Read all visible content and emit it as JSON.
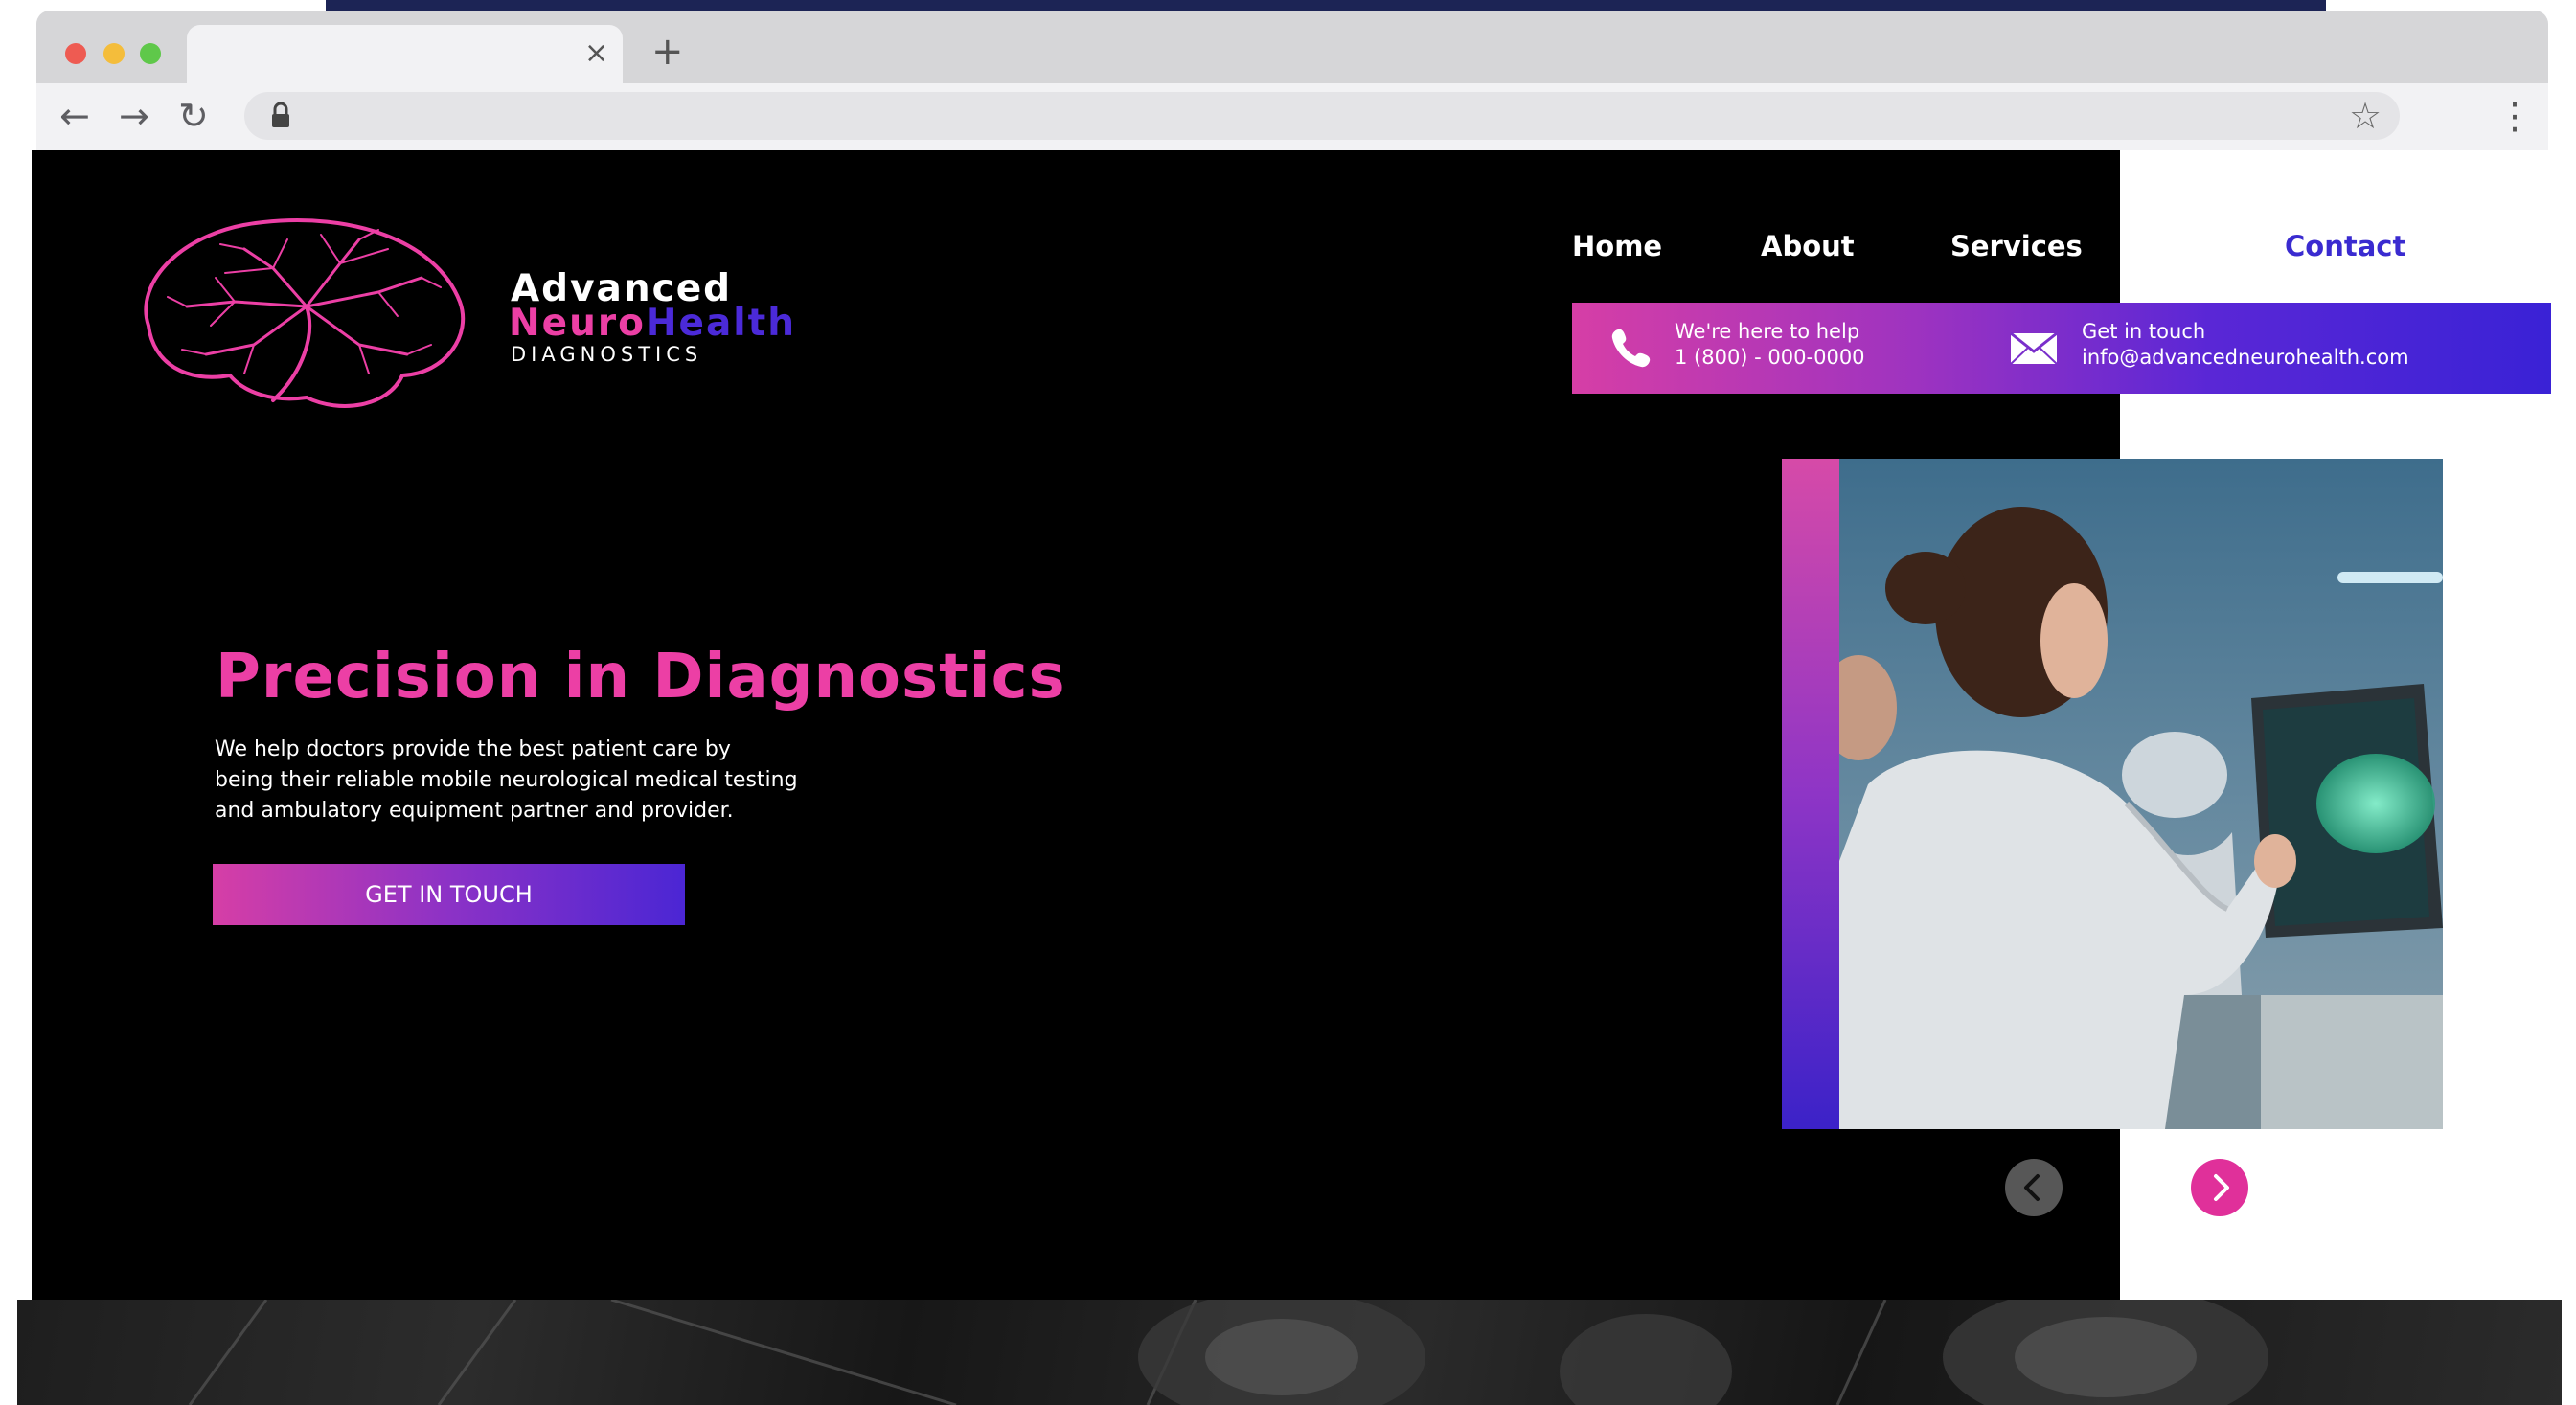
{
  "browser": {
    "tab_close_glyph": "×",
    "new_tab_glyph": "+",
    "back_glyph": "←",
    "forward_glyph": "→",
    "reload_glyph": "↻",
    "bookmark_glyph": "☆",
    "menu_glyph": "⋮",
    "icons": [
      "back-icon",
      "forward-icon",
      "reload-icon",
      "lock-icon",
      "star-icon",
      "kebab-menu-icon"
    ]
  },
  "logo": {
    "line1": "Advanced",
    "line2_part1": "Neuro",
    "line2_part2": "Health",
    "line3": "DIAGNOSTICS",
    "colors": {
      "neuro": "#ec3fa5",
      "health": "#4b2ad8",
      "brain": "#ec3fa5"
    }
  },
  "nav": {
    "items": [
      {
        "label": "Home"
      },
      {
        "label": "About"
      },
      {
        "label": "Services"
      },
      {
        "label": "Contact"
      }
    ],
    "active": "Contact",
    "active_color": "#3a2bd0"
  },
  "contact_bar": {
    "phone_caption": "We're here to help",
    "phone_number": "1 (800) - 000-0000",
    "email_caption": "Get in touch",
    "email_address": "info@advancedneurohealth.com"
  },
  "hero": {
    "title": "Precision in Diagnostics",
    "body_line1": "We help doctors provide the best patient care by",
    "body_line2": "being their reliable mobile neurological medical testing",
    "body_line3": "and ambulatory equipment partner and provider.",
    "cta_label": "GET IN TOUCH",
    "accent_color": "#ec3fa5"
  },
  "slider": {
    "prev_icon": "chevron-left-icon",
    "next_icon": "chevron-right-icon"
  }
}
